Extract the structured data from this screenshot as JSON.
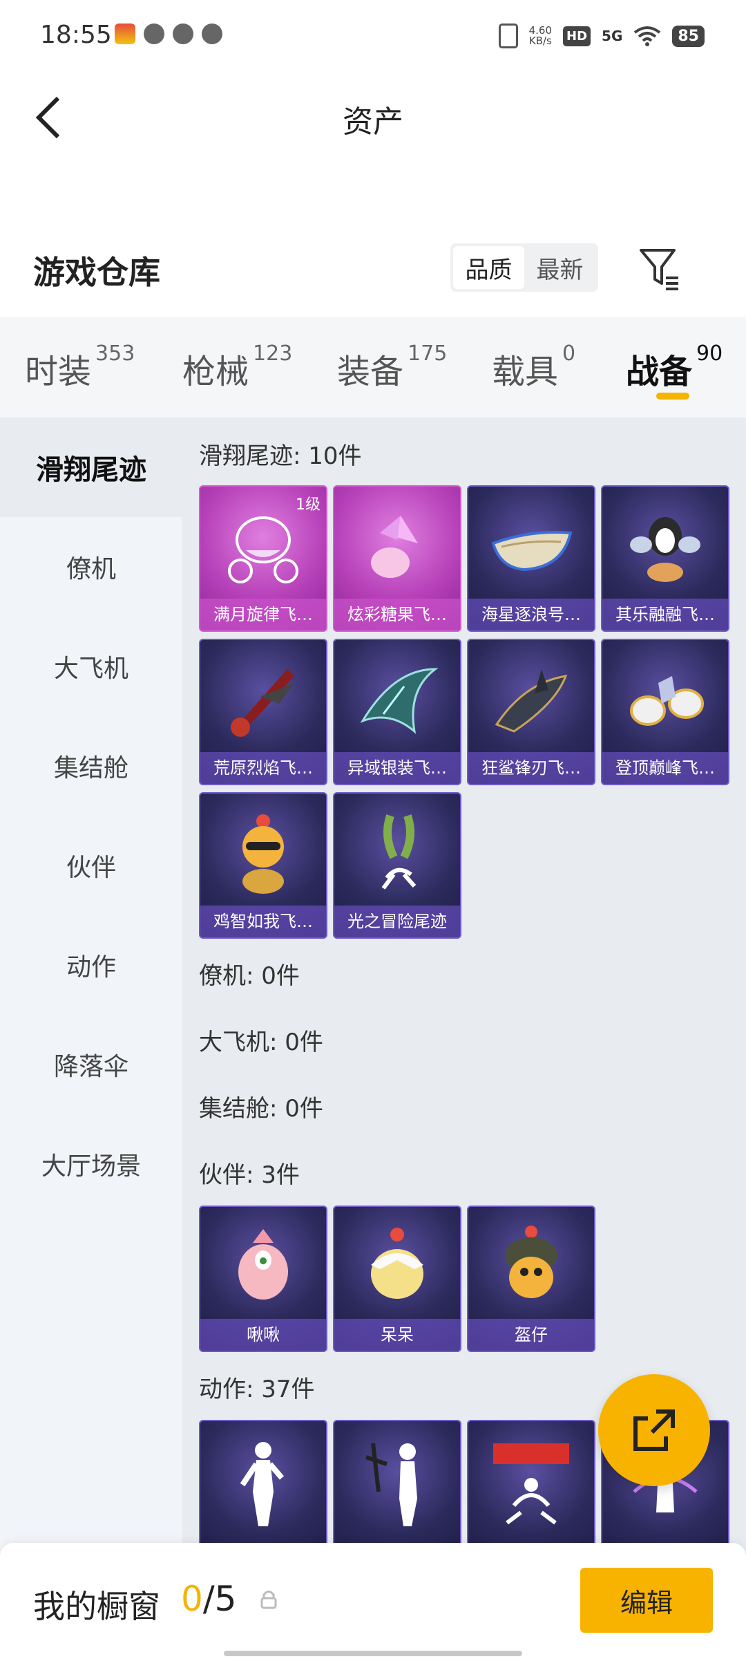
{
  "status_bar": {
    "time": "18:55",
    "net_speed_value": "4.60",
    "net_speed_unit": "KB/s",
    "hd": "HD",
    "signal": "5G",
    "battery": "85"
  },
  "header": {
    "title": "资产"
  },
  "warehouse": {
    "title": "游戏仓库",
    "sort_options": [
      "品质",
      "最新"
    ],
    "sort_selected": "品质"
  },
  "tabs": [
    {
      "label": "时装",
      "count": "353"
    },
    {
      "label": "枪械",
      "count": "123"
    },
    {
      "label": "装备",
      "count": "175"
    },
    {
      "label": "载具",
      "count": "0"
    },
    {
      "label": "战备",
      "count": "90",
      "active": true
    }
  ],
  "sidenav": [
    "滑翔尾迹",
    "僚机",
    "大飞机",
    "集结舱",
    "伙伴",
    "动作",
    "降落伞",
    "大厅场景"
  ],
  "sections": {
    "glide": {
      "title": "滑翔尾迹: 10件",
      "items": [
        {
          "name": "满月旋律飞…",
          "badge": "1级",
          "icon": "carriage-icon"
        },
        {
          "name": "炫彩糖果飞…",
          "icon": "candy-icon"
        },
        {
          "name": "海星逐浪号…",
          "icon": "boat-icon"
        },
        {
          "name": "其乐融融飞…",
          "icon": "penguin-icon"
        },
        {
          "name": "荒原烈焰飞…",
          "icon": "jet-icon"
        },
        {
          "name": "异域银装飞…",
          "icon": "wing-icon"
        },
        {
          "name": "狂鲨锋刃飞…",
          "icon": "shark-icon"
        },
        {
          "name": "登顶巅峰飞…",
          "icon": "rocket-icon"
        },
        {
          "name": "鸡智如我飞…",
          "icon": "chicken-icon"
        },
        {
          "name": "光之冒险尾迹",
          "icon": "smoke-trail-icon"
        }
      ]
    },
    "wingman": {
      "title": "僚机: 0件"
    },
    "plane": {
      "title": "大飞机: 0件"
    },
    "pod": {
      "title": "集结舱: 0件"
    },
    "companion": {
      "title": "伙伴: 3件",
      "items": [
        {
          "name": "啾啾",
          "icon": "pink-bird-icon"
        },
        {
          "name": "呆呆",
          "icon": "chick-icon"
        },
        {
          "name": "盔仔",
          "icon": "helmet-chick-icon"
        }
      ]
    },
    "emote": {
      "title": "动作: 37件"
    }
  },
  "bottom": {
    "label": "我的橱窗",
    "current": "0",
    "total": "/5",
    "edit": "编辑"
  }
}
